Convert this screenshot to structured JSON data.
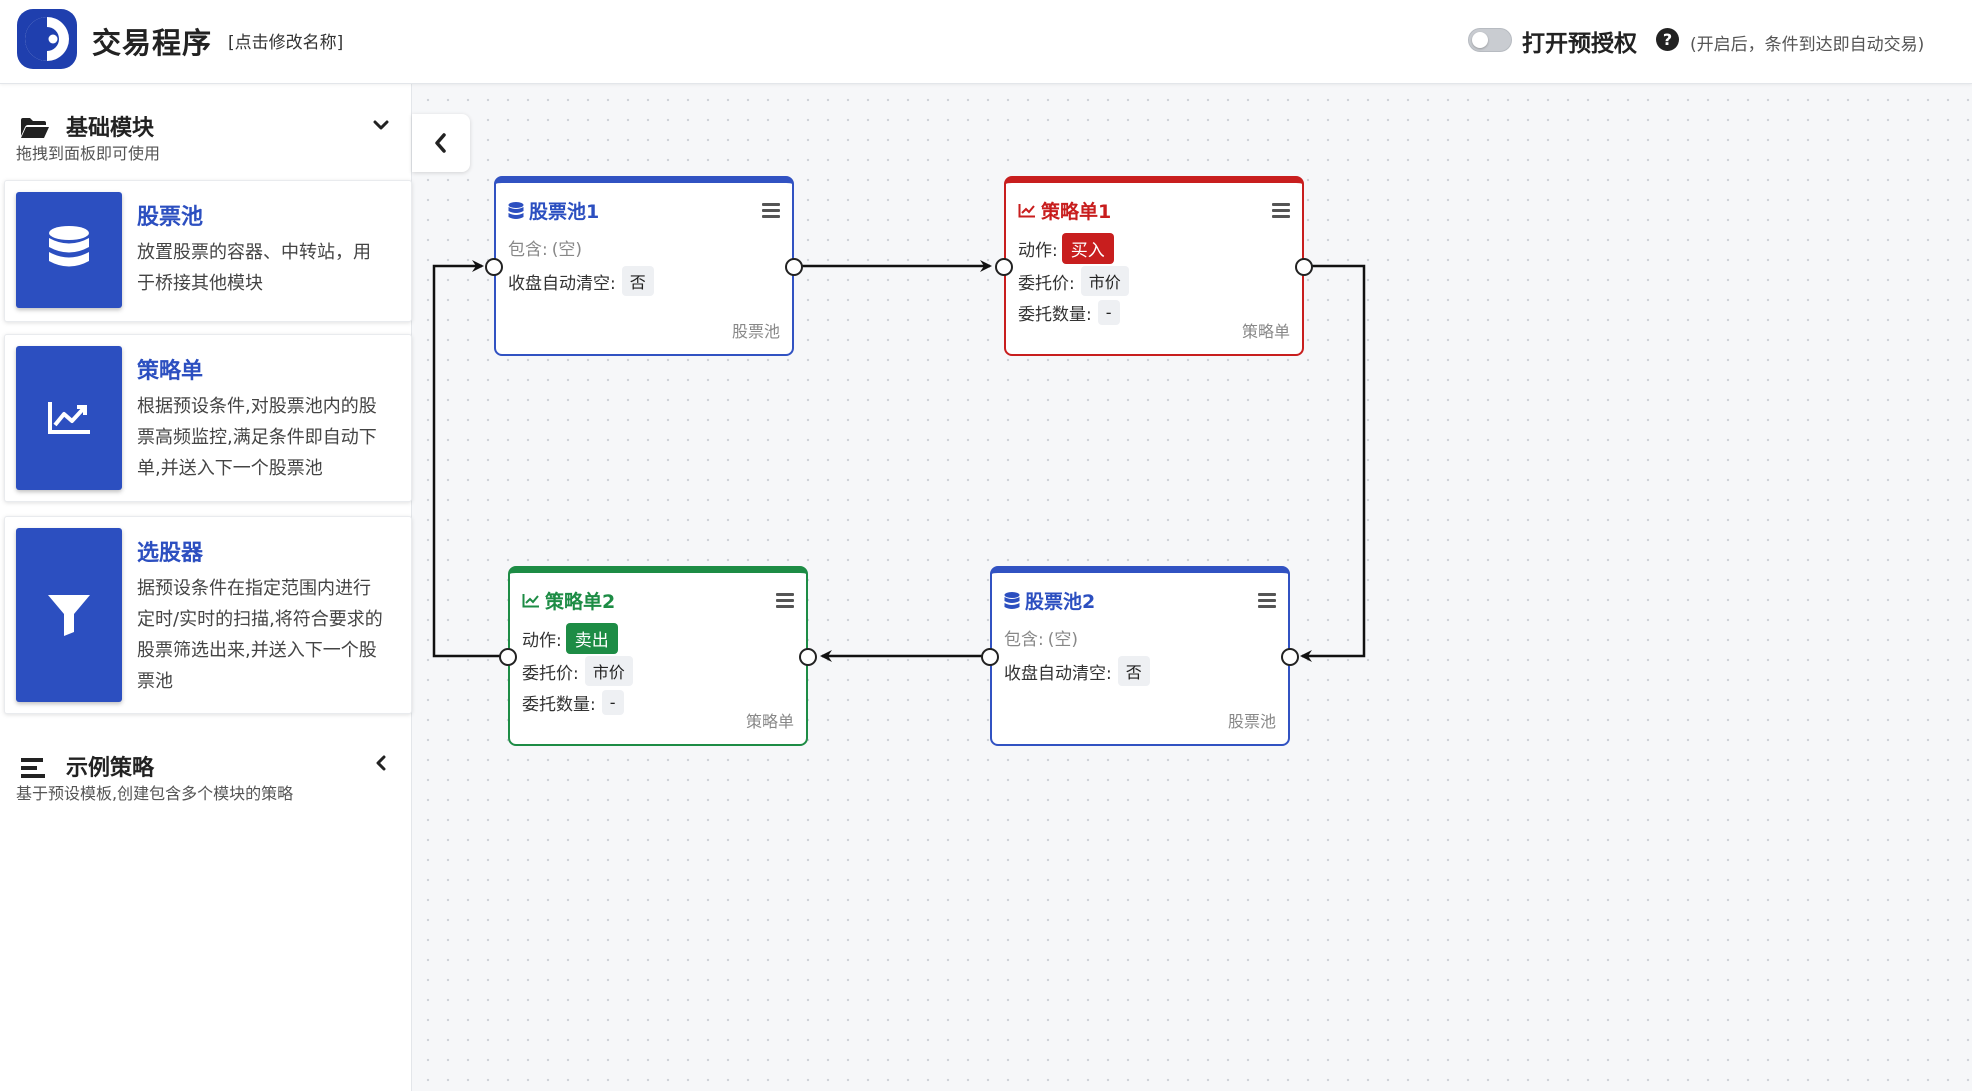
{
  "header": {
    "app_title": "交易程序",
    "rename_link": "[点击修改名称]",
    "auth_label": "打开预授权",
    "help_symbol": "?",
    "auth_note": "(开启后，条件到达即自动交易)",
    "auth_enabled": false
  },
  "sidebar": {
    "basic_modules": {
      "title": "基础模块",
      "subtitle": "拖拽到面板即可使用",
      "expanded": true
    },
    "cards": [
      {
        "title": "股票池",
        "description": "放置股票的容器、中转站，用于桥接其他模块",
        "icon": "database-icon"
      },
      {
        "title": "策略单",
        "description": "根据预设条件,对股票池内的股票高频监控,满足条件即自动下单,并送入下一个股票池",
        "icon": "chart-line-icon"
      },
      {
        "title": "选股器",
        "description": "据预设条件在指定范围内进行定时/实时的扫描,将符合要求的股票筛选出来,并送入下一个股票池",
        "icon": "filter-icon"
      }
    ],
    "example_strategies": {
      "title": "示例策略",
      "subtitle": "基于预设模板,创建包含多个模块的策略",
      "expanded": false
    }
  },
  "nodes": {
    "pool1": {
      "title": "股票池1",
      "contains_label": "包含:",
      "contains_value": "(空)",
      "autoclear_label": "收盘自动清空:",
      "autoclear_value": "否",
      "type_label": "股票池"
    },
    "strategy1": {
      "title": "策略单1",
      "action_label": "动作:",
      "action_value": "买入",
      "price_label": "委托价:",
      "price_value": "市价",
      "qty_label": "委托数量:",
      "qty_value": "-",
      "type_label": "策略单"
    },
    "strategy2": {
      "title": "策略单2",
      "action_label": "动作:",
      "action_value": "卖出",
      "price_label": "委托价:",
      "price_value": "市价",
      "qty_label": "委托数量:",
      "qty_value": "-",
      "type_label": "策略单"
    },
    "pool2": {
      "title": "股票池2",
      "contains_label": "包含:",
      "contains_value": "(空)",
      "autoclear_label": "收盘自动清空:",
      "autoclear_value": "否",
      "type_label": "股票池"
    }
  },
  "colors": {
    "primary": "#2c4fc0",
    "buy": "#c81e1e",
    "sell": "#1d8c45"
  }
}
